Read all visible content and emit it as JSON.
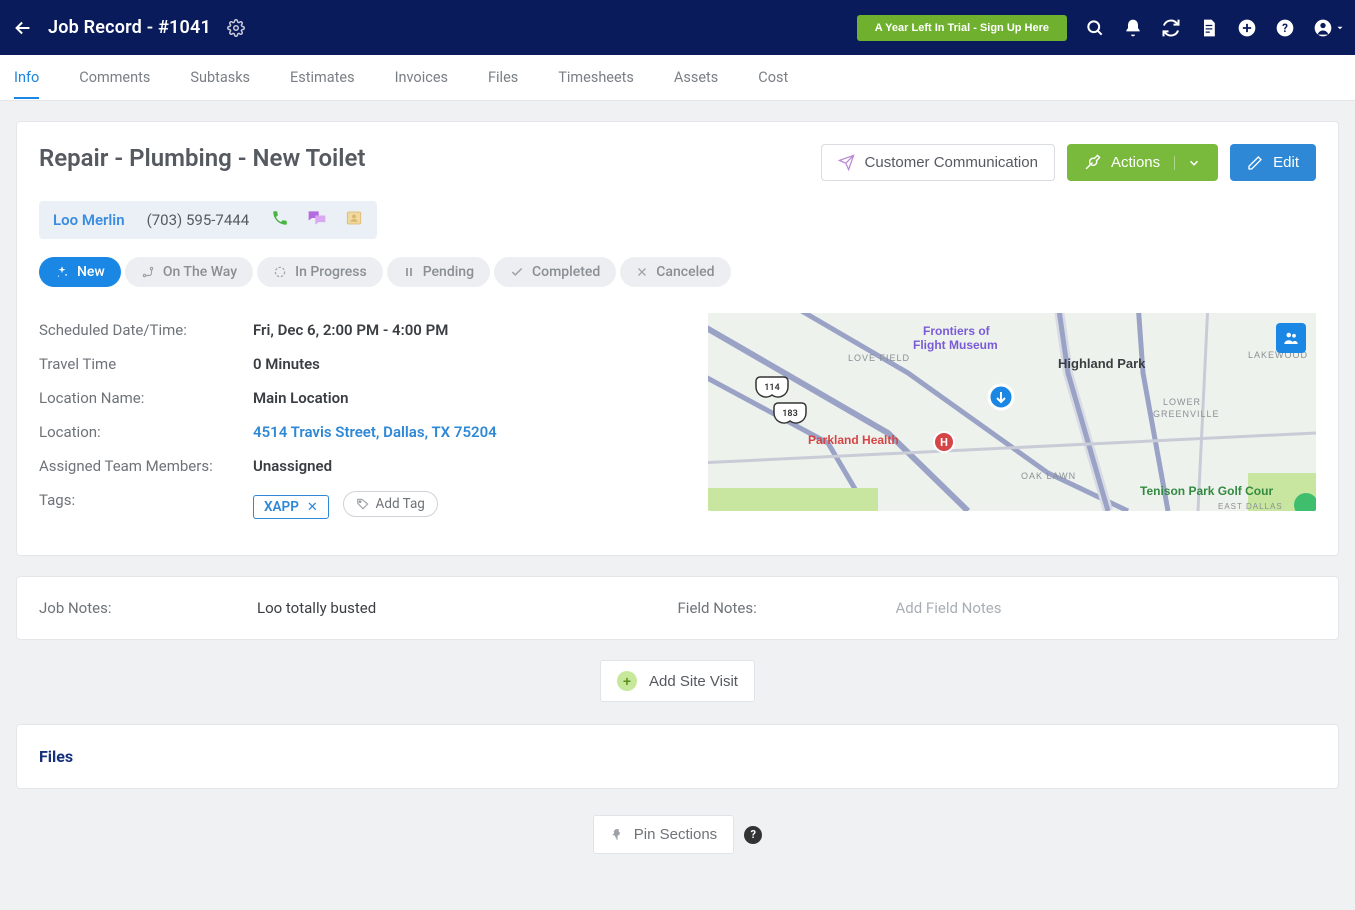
{
  "header": {
    "title": "Job Record - #1041",
    "trial_label": "A Year Left In Trial - Sign Up Here"
  },
  "tabs": [
    {
      "label": "Info",
      "active": true
    },
    {
      "label": "Comments"
    },
    {
      "label": "Subtasks"
    },
    {
      "label": "Estimates"
    },
    {
      "label": "Invoices"
    },
    {
      "label": "Files"
    },
    {
      "label": "Timesheets"
    },
    {
      "label": "Assets"
    },
    {
      "label": "Cost"
    }
  ],
  "job": {
    "title": "Repair - Plumbing - New Toilet",
    "customer": {
      "name": "Loo Merlin",
      "phone": "(703) 595-7444"
    },
    "statuses": [
      {
        "label": "New",
        "active": true,
        "icon": "sparkle"
      },
      {
        "label": "On The Way",
        "icon": "route"
      },
      {
        "label": "In Progress",
        "icon": "spinner"
      },
      {
        "label": "Pending",
        "icon": "pause"
      },
      {
        "label": "Completed",
        "icon": "check"
      },
      {
        "label": "Canceled",
        "icon": "x"
      }
    ],
    "details": {
      "scheduled_label": "Scheduled Date/Time:",
      "scheduled_value": "Fri, Dec 6, 2:00 PM - 4:00 PM",
      "travel_label": "Travel Time",
      "travel_value": "0 Minutes",
      "location_name_label": "Location Name:",
      "location_name_value": "Main Location",
      "location_label": "Location:",
      "location_value": "4514 Travis Street, Dallas, TX 75204",
      "assigned_label": "Assigned Team Members:",
      "assigned_value": "Unassigned",
      "tags_label": "Tags:",
      "tags": [
        "XAPP"
      ],
      "add_tag_label": "Add Tag"
    }
  },
  "buttons": {
    "customer_comm": "Customer Communication",
    "actions": "Actions",
    "edit": "Edit",
    "add_site_visit": "Add Site Visit",
    "pin_sections": "Pin Sections"
  },
  "notes": {
    "job_label": "Job Notes:",
    "job_value": "Loo totally busted",
    "field_label": "Field Notes:",
    "field_placeholder": "Add Field Notes"
  },
  "files_section": {
    "title": "Files"
  },
  "map": {
    "labels": [
      "Frontiers of Flight Museum",
      "LOVE FIELD",
      "Highland Park",
      "LAKEWOOD",
      "LOWER GREENVILLE",
      "Parkland Health",
      "OAK LAWN",
      "Tenison Park Golf Cour",
      "114",
      "183"
    ],
    "pin_marker": "H"
  }
}
